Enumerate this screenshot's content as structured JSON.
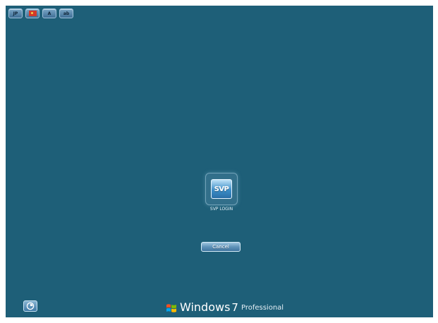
{
  "top_toolbar": {
    "buttons": [
      {
        "label": "JP",
        "icon": "language-jp-icon"
      },
      {
        "label": "",
        "icon": "flag-icon"
      },
      {
        "label": "A",
        "icon": "font-a-icon"
      },
      {
        "label": "ab",
        "icon": "input-mode-icon"
      }
    ]
  },
  "login_tile": {
    "icon_text": "SVP",
    "label": "SVP LOGIN"
  },
  "cancel_label": "Cancel",
  "branding": {
    "name": "Windows",
    "version": "7",
    "edition": "Professional"
  },
  "colors": {
    "background": "#1e5f78",
    "accent": "#3c8ec8"
  }
}
